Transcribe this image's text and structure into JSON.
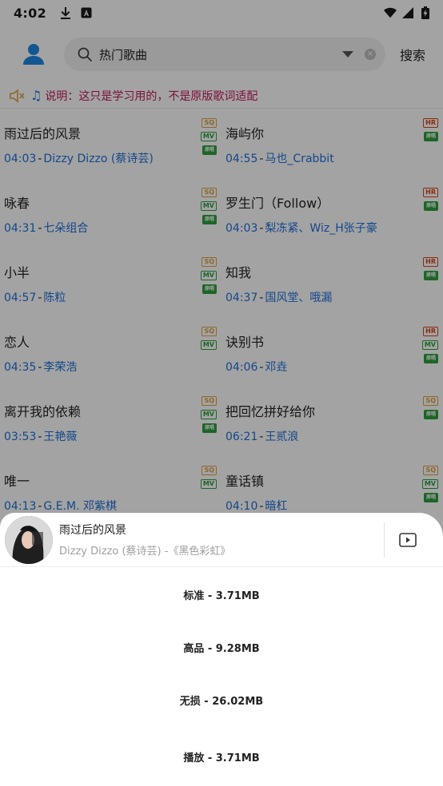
{
  "status": {
    "time": "4:02"
  },
  "search": {
    "value": "热门歌曲",
    "button_label": "搜索"
  },
  "notice": {
    "text": "说明：这只是学习用的，不是原版歌词适配"
  },
  "songs": [
    {
      "name": "雨过后的风景",
      "duration": "04:03",
      "artist": "Dizzy Dizzo (蔡诗芸)",
      "badges": [
        "SQ",
        "MV",
        "原唱"
      ]
    },
    {
      "name": "海屿你",
      "duration": "04:55",
      "artist": "马也_Crabbit",
      "badges": [
        "HR",
        "原唱"
      ]
    },
    {
      "name": "咏春",
      "duration": "04:31",
      "artist": "七朵组合",
      "badges": [
        "SQ",
        "MV",
        "原唱"
      ]
    },
    {
      "name": "罗生门（Follow）",
      "duration": "04:03",
      "artist": "梨冻紧、Wiz_H张子豪",
      "badges": [
        "HR",
        "原唱"
      ]
    },
    {
      "name": "小半",
      "duration": "04:57",
      "artist": "陈粒",
      "badges": [
        "SQ",
        "MV",
        "原唱"
      ]
    },
    {
      "name": "知我",
      "duration": "04:37",
      "artist": "国风堂、哦漏",
      "badges": [
        "HR",
        "原唱"
      ]
    },
    {
      "name": "恋人",
      "duration": "04:35",
      "artist": "李荣浩",
      "badges": [
        "SQ",
        "MV"
      ]
    },
    {
      "name": "诀别书",
      "duration": "04:06",
      "artist": "邓垚",
      "badges": [
        "HR",
        "MV",
        "原唱"
      ]
    },
    {
      "name": "离开我的依赖",
      "duration": "03:53",
      "artist": "王艳薇",
      "badges": [
        "SQ",
        "MV",
        "原唱"
      ]
    },
    {
      "name": "把回忆拼好给你",
      "duration": "06:21",
      "artist": "王贰浪",
      "badges": [
        "SQ",
        "原唱"
      ]
    },
    {
      "name": "唯一",
      "duration": "04:13",
      "artist": "G.E.M. 邓紫棋",
      "badges": [
        "SQ",
        "MV"
      ]
    },
    {
      "name": "童话镇",
      "duration": "04:10",
      "artist": "暗杠",
      "badges": [
        "SQ",
        "MV",
        "原唱"
      ]
    }
  ],
  "sheet": {
    "title": "雨过后的风景",
    "subtitle": "Dizzy Dizzo (蔡诗芸) -《黑色彩虹》",
    "options": [
      "标准 - 3.71MB",
      "高品 - 9.28MB",
      "无损 - 26.02MB",
      "播放 - 3.71MB"
    ]
  },
  "colors": {
    "accent": "#1e6fd9",
    "notice": "#c2185b",
    "overlay": "rgba(0,0,0,0.36)"
  }
}
